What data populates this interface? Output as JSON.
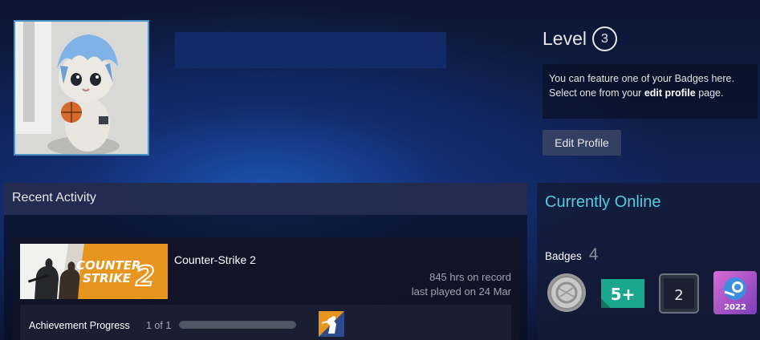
{
  "profile": {
    "level_label": "Level",
    "level_value": "3",
    "feature_text_1": "You can feature one of your Badges here.",
    "feature_text_2_pre": "Select one from your ",
    "feature_text_2_link": "edit profile",
    "feature_text_2_post": " page.",
    "edit_profile_label": "Edit Profile"
  },
  "recent_activity": {
    "header": "Recent Activity",
    "game": {
      "name": "Counter-Strike 2",
      "hours": "845 hrs on record",
      "last_played": "last played on 24 Mar",
      "capsule_line1": "COUNTER",
      "capsule_line2": "STRIKE",
      "capsule_number": "2"
    },
    "achievements": {
      "label": "Achievement Progress",
      "count": "1 of 1",
      "progress_fraction": 1.0
    }
  },
  "sidebar": {
    "status": "Currently Online",
    "badges_label": "Badges",
    "badges_count": "4",
    "badge_items": [
      {
        "name": "coin-badge-icon"
      },
      {
        "name": "five-plus-badge-icon",
        "text": "5+"
      },
      {
        "name": "years-badge-icon",
        "text": "2"
      },
      {
        "name": "steam-2022-badge-icon",
        "text": "2022"
      }
    ]
  },
  "colors": {
    "accent_online": "#57cbde",
    "capsule_orange": "#e8951f",
    "badge_teal": "#1aa78e",
    "badge_purple": "#b24fd0"
  }
}
